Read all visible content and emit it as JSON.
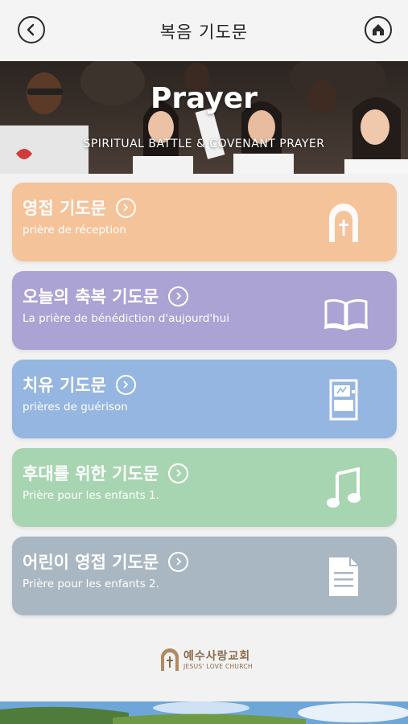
{
  "header": {
    "title": "복음 기도문"
  },
  "banner": {
    "title": "Prayer",
    "subtitle": "SPIRITUAL BATTLE & COVENANT PRAYER"
  },
  "cards": [
    {
      "title": "영접 기도문",
      "subtitle": "prière de réception",
      "color": "#f4c39a",
      "icon": "church-arch-cross-icon"
    },
    {
      "title": "오늘의 축복 기도문",
      "subtitle": "La prière de bénédiction d'aujourd'hui",
      "color": "#aaa3d4",
      "icon": "open-book-icon"
    },
    {
      "title": "치유 기도문",
      "subtitle": "prières de guérison",
      "color": "#95b6e0",
      "icon": "healing-document-icon"
    },
    {
      "title": "후대를 위한 기도문",
      "subtitle": "Prière pour les enfants 1.",
      "color": "#a8d5b1",
      "icon": "music-note-icon"
    },
    {
      "title": "어린이 영접 기도문",
      "subtitle": "Prière pour les enfants 2.",
      "color": "#a9b7c2",
      "icon": "document-icon"
    }
  ],
  "footer": {
    "logo_ko": "예수사랑교회",
    "logo_en": "JESUS' LOVE CHURCH"
  }
}
